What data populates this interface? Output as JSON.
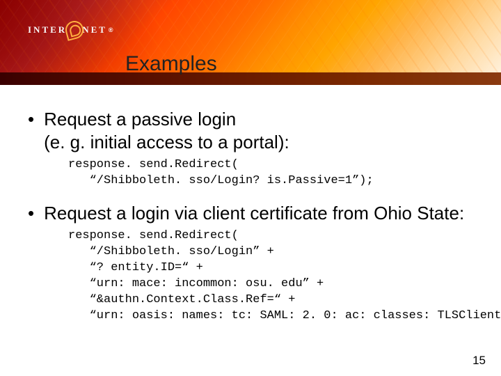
{
  "logo": {
    "part1": "INTER",
    "part2": "NET",
    "registered": "®"
  },
  "title": "Examples",
  "bullets": [
    {
      "text": "Request a passive login\n(e. g. initial access to a portal):",
      "code": "response. send.Redirect(\n   “/Shibboleth. sso/Login? is.Passive=1”);"
    },
    {
      "text": "Request a login via client certificate from Ohio State:",
      "code": "response. send.Redirect(\n   “/Shibboleth. sso/Login” +\n   “? entity.ID=“ +\n   “urn: mace: incommon: osu. edu” +\n   “&authn.Context.Class.Ref=“ +\n   “urn: oasis: names: tc: SAML: 2. 0: ac: classes: TLSClient”);"
    }
  ],
  "page_number": "15"
}
